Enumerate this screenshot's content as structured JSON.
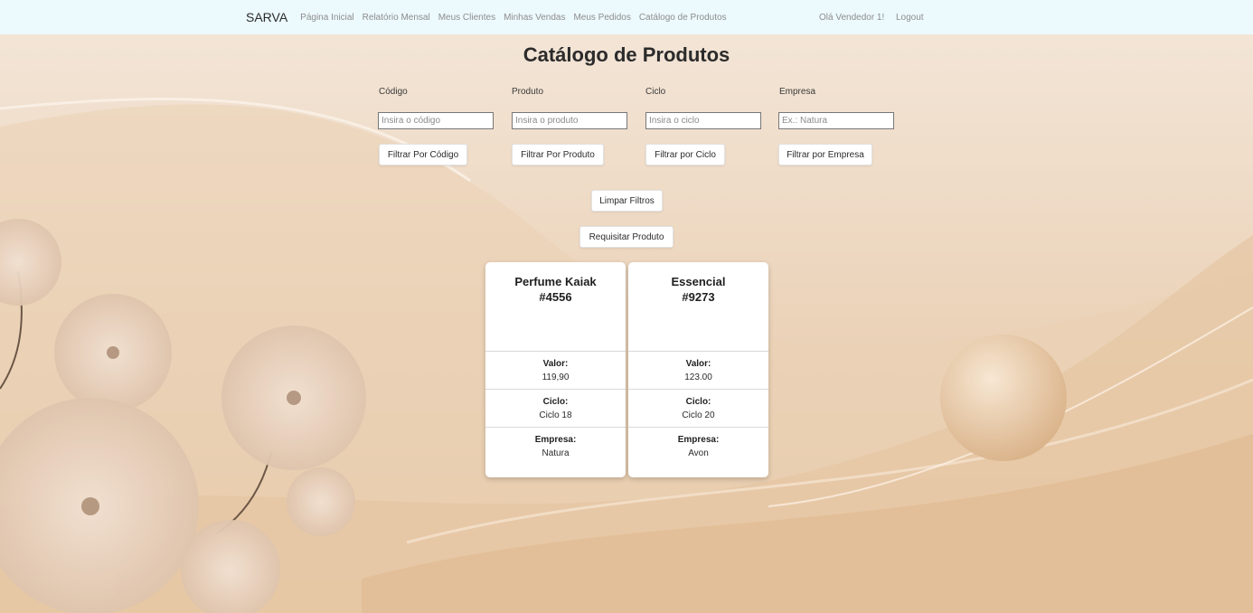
{
  "nav": {
    "brand": "SARVA",
    "links": [
      "Página Inicial",
      "Relatório Mensal",
      "Meus Clientes",
      "Minhas Vendas",
      "Meus Pedidos",
      "Catálogo de Produtos"
    ],
    "greeting": "Olá Vendedor 1!",
    "logout": "Logout"
  },
  "page": {
    "title": "Catálogo de Produtos"
  },
  "filters": {
    "codigo": {
      "label": "Código",
      "placeholder": "Insira o código",
      "button": "Filtrar Por Código"
    },
    "produto": {
      "label": "Produto",
      "placeholder": "Insira o produto",
      "button": "Filtrar Por Produto"
    },
    "ciclo": {
      "label": "Ciclo",
      "placeholder": "Insira o ciclo",
      "button": "Filtrar por Ciclo"
    },
    "empresa": {
      "label": "Empresa",
      "placeholder": "Ex.: Natura",
      "button": "Filtrar por Empresa"
    }
  },
  "actions": {
    "clear": "Limpar Filtros",
    "request": "Requisitar Produto"
  },
  "products": [
    {
      "name": "Perfume Kaiak",
      "code": "#4556",
      "valor_label": "Valor:",
      "valor": "119,90",
      "ciclo_label": "Ciclo:",
      "ciclo": "Ciclo 18",
      "empresa_label": "Empresa:",
      "empresa": "Natura"
    },
    {
      "name": "Essencial",
      "code": "#9273",
      "valor_label": "Valor:",
      "valor": "123.00",
      "ciclo_label": "Ciclo:",
      "ciclo": "Ciclo 20",
      "empresa_label": "Empresa:",
      "empresa": "Avon"
    }
  ]
}
